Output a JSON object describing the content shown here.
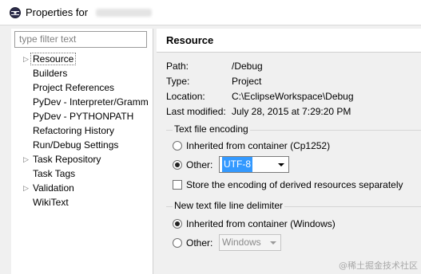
{
  "window": {
    "title": "Properties for"
  },
  "filter": {
    "placeholder": "type filter text"
  },
  "tree": [
    {
      "label": "Resource",
      "expandable": true,
      "selected": true
    },
    {
      "label": "Builders",
      "expandable": false
    },
    {
      "label": "Project References",
      "expandable": false
    },
    {
      "label": "PyDev - Interpreter/Gramm",
      "expandable": false
    },
    {
      "label": "PyDev - PYTHONPATH",
      "expandable": false
    },
    {
      "label": "Refactoring History",
      "expandable": false
    },
    {
      "label": "Run/Debug Settings",
      "expandable": false
    },
    {
      "label": "Task Repository",
      "expandable": true
    },
    {
      "label": "Task Tags",
      "expandable": false
    },
    {
      "label": "Validation",
      "expandable": true
    },
    {
      "label": "WikiText",
      "expandable": false
    }
  ],
  "page": {
    "title": "Resource",
    "props": {
      "path_label": "Path:",
      "path_value": "/Debug",
      "type_label": "Type:",
      "type_value": "Project",
      "location_label": "Location:",
      "location_value": "C:\\EclipseWorkspace\\Debug",
      "modified_label": "Last modified:",
      "modified_value": "July 28, 2015 at 7:29:20 PM"
    },
    "encoding": {
      "legend": "Text file encoding",
      "inherited_label": "Inherited from container (Cp1252)",
      "other_label": "Other:",
      "other_value": "UTF-8",
      "store_label": "Store the encoding of derived resources separately"
    },
    "delimiter": {
      "legend": "New text file line delimiter",
      "inherited_label": "Inherited from container (Windows)",
      "other_label": "Other:",
      "other_value": "Windows"
    }
  },
  "watermark": "@稀土掘金技术社区",
  "icons": {
    "app": "eclipse-icon",
    "expand": "chevron-right-icon",
    "dropdown": "chevron-down-icon"
  }
}
